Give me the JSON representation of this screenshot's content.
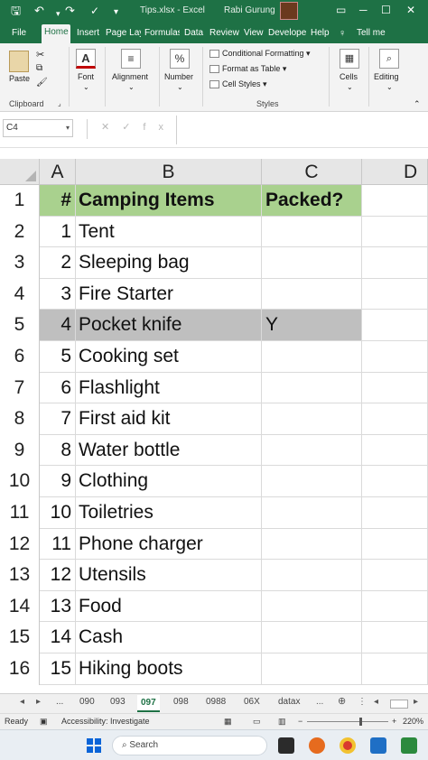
{
  "title_bar": {
    "title": "Tips.xlsx - Excel",
    "user": "Rabi Gurung",
    "quick_access": {
      "save": "🖫",
      "undo": "↶",
      "redo": "↷"
    },
    "window_controls": {
      "minimize": "─",
      "restore": "☐",
      "close": "✕"
    }
  },
  "ribbon_tabs": [
    "File",
    "Home",
    "Insert",
    "Page Lay",
    "Formulas",
    "Data",
    "Review",
    "View",
    "Develope",
    "Help",
    "Tell me"
  ],
  "ribbon_active_tab": "Home",
  "ribbon": {
    "clipboard": {
      "paste": "Paste",
      "group": "Clipboard"
    },
    "font": {
      "label": "Font"
    },
    "alignment": {
      "label": "Alignment"
    },
    "number": {
      "label": "Number",
      "symbol": "%"
    },
    "styles": {
      "conditional": "Conditional Formatting",
      "format_table": "Format as Table",
      "cell_styles": "Cell Styles",
      "group": "Styles"
    },
    "cells": {
      "label": "Cells"
    },
    "editing": {
      "label": "Editing"
    }
  },
  "formula_bar": {
    "name_box": "C4",
    "icons": "✕✓fx",
    "value": ""
  },
  "grid": {
    "columns": [
      "A",
      "B",
      "C",
      "D"
    ],
    "row_numbers": [
      "1",
      "2",
      "3",
      "4",
      "5",
      "6",
      "7",
      "8",
      "9",
      "10",
      "11",
      "12",
      "13",
      "14",
      "15",
      "16"
    ],
    "header": {
      "a": "#",
      "b": "Camping Items",
      "c": "Packed?"
    },
    "rows": [
      {
        "a": "1",
        "b": "Tent",
        "c": ""
      },
      {
        "a": "2",
        "b": "Sleeping bag",
        "c": ""
      },
      {
        "a": "3",
        "b": "Fire Starter",
        "c": ""
      },
      {
        "a": "4",
        "b": "Pocket knife",
        "c": "Y"
      },
      {
        "a": "5",
        "b": "Cooking set",
        "c": ""
      },
      {
        "a": "6",
        "b": "Flashlight",
        "c": ""
      },
      {
        "a": "7",
        "b": "First aid kit",
        "c": ""
      },
      {
        "a": "8",
        "b": "Water bottle",
        "c": ""
      },
      {
        "a": "9",
        "b": "Clothing",
        "c": ""
      },
      {
        "a": "10",
        "b": "Toiletries",
        "c": ""
      },
      {
        "a": "11",
        "b": "Phone charger",
        "c": ""
      },
      {
        "a": "12",
        "b": "Utensils",
        "c": ""
      },
      {
        "a": "13",
        "b": "Food",
        "c": ""
      },
      {
        "a": "14",
        "b": "Cash",
        "c": ""
      },
      {
        "a": "15",
        "b": "Hiking boots",
        "c": ""
      }
    ],
    "highlighted_row_number": "5",
    "colors": {
      "header_fill": "#a9d18e",
      "highlight_fill": "#bfbfbf"
    }
  },
  "sheet_tabs": [
    "...",
    "090",
    "093",
    "097",
    "098",
    "0988",
    "06X",
    "datax"
  ],
  "active_sheet": "097",
  "status_bar": {
    "ready": "Ready",
    "accessibility": "Accessibility: Investigate",
    "zoom": "220%"
  },
  "taskbar": {
    "search": "Search"
  }
}
